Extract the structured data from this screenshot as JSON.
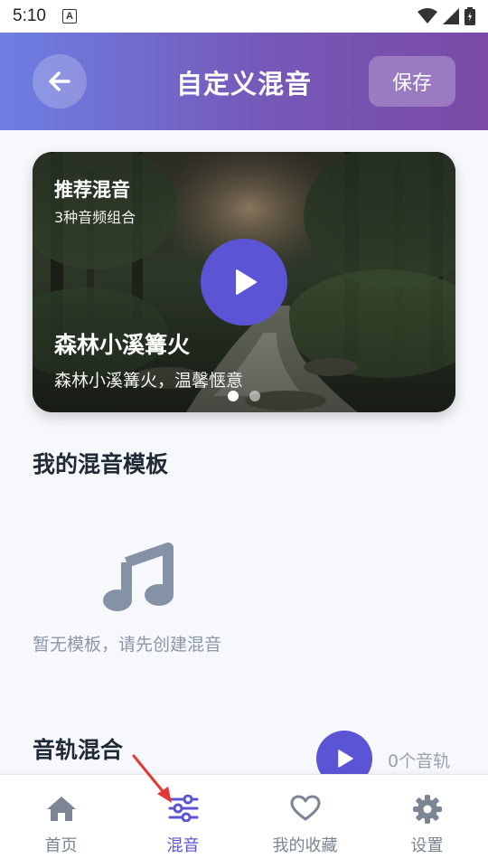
{
  "status": {
    "time": "5:10",
    "a_badge": "A"
  },
  "header": {
    "title": "自定义混音",
    "save_label": "保存",
    "back_icon": "arrow-left-icon"
  },
  "banner": {
    "tag": "推荐混音",
    "subtitle": "3种音频组合",
    "title": "森林小溪篝火",
    "description": "森林小溪篝火，温馨惬意",
    "dots_total": 2,
    "dots_active_index": 0
  },
  "templates": {
    "title": "我的混音模板",
    "empty_text": "暂无模板，请先创建混音",
    "icon": "music-note-icon"
  },
  "mix": {
    "title": "音轨混合",
    "track_count": "0个音轨"
  },
  "nav": {
    "items": [
      {
        "label": "首页",
        "icon": "home-icon",
        "active": false
      },
      {
        "label": "混音",
        "icon": "sliders-icon",
        "active": true
      },
      {
        "label": "我的收藏",
        "icon": "heart-icon",
        "active": false
      },
      {
        "label": "设置",
        "icon": "gear-icon",
        "active": false
      }
    ]
  },
  "colors": {
    "accent": "#5b55d6",
    "header_start": "#6d7fe3",
    "header_end": "#7a4aa6",
    "annotation": "#e53935"
  }
}
